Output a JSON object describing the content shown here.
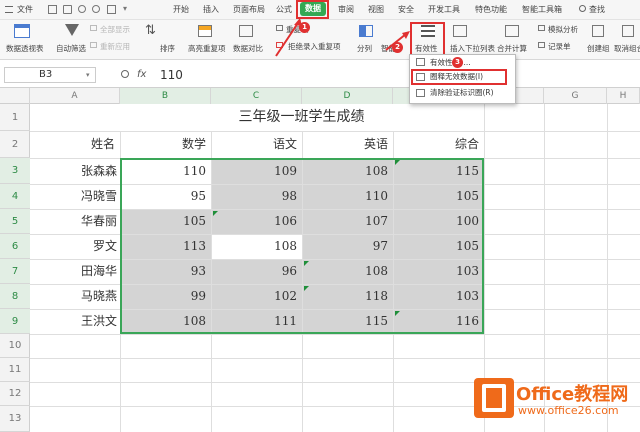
{
  "menubar": {
    "file": "文件",
    "start": "开始",
    "insert": "插入",
    "layout": "页面布局",
    "formula": "公式",
    "data": "数据",
    "review": "审阅",
    "view": "视图",
    "security": "安全",
    "dev": "开发工具",
    "special": "特色功能",
    "smart": "智能工具箱",
    "search": "查找"
  },
  "ribbon": {
    "pivot": "数据透视表",
    "autofilter": "自动筛选",
    "show_all": "全部显示",
    "reapply": "重新应用",
    "sort": "排序",
    "highlight_dup": "高亮重复项",
    "compare": "数据对比",
    "dup_item": "重复项",
    "reject_dup": "拒绝录入重复项",
    "split": "分列",
    "smart_fill": "智能",
    "validation": "有效性",
    "insert_dropdown": "插入下拉列表",
    "consolidate": "合并计算",
    "simulate": "模拟分析",
    "record": "记录单",
    "group": "创建组",
    "ungroup": "取消组合"
  },
  "dropdown": {
    "items": [
      "有效性(V)...",
      "圈释无效数据(I)",
      "清除验证标识圈(R)"
    ]
  },
  "formula_bar": {
    "cell_ref": "B3",
    "fx": "fx",
    "value": "110"
  },
  "callouts": [
    "1",
    "2",
    "3"
  ],
  "columns": [
    "A",
    "B",
    "C",
    "D",
    "E",
    "F",
    "G",
    "H"
  ],
  "rows": [
    "1",
    "2",
    "3",
    "4",
    "5",
    "6",
    "7",
    "8",
    "9",
    "10",
    "11",
    "12",
    "13"
  ],
  "sheet": {
    "title": "三年级一班学生成绩",
    "headers": [
      "姓名",
      "数学",
      "语文",
      "英语",
      "综合"
    ],
    "students": [
      {
        "name": "张森森",
        "scores": [
          110,
          109,
          108,
          115
        ]
      },
      {
        "name": "冯晓雪",
        "scores": [
          95,
          98,
          110,
          105
        ]
      },
      {
        "name": "华春丽",
        "scores": [
          105,
          106,
          107,
          100
        ]
      },
      {
        "name": "罗文",
        "scores": [
          113,
          108,
          97,
          105
        ]
      },
      {
        "name": "田海华",
        "scores": [
          93,
          96,
          108,
          103
        ]
      },
      {
        "name": "马晓燕",
        "scores": [
          99,
          102,
          118,
          103
        ]
      },
      {
        "name": "王洪文",
        "scores": [
          108,
          111,
          115,
          116
        ]
      }
    ]
  },
  "watermark": {
    "line1": "Office教程网",
    "line2": "www.office26.com"
  },
  "colors": {
    "accent": "#34a853",
    "selection": "#3aa658",
    "invalid_fill": "#d4d4d4",
    "annotation": "#e03030",
    "watermark": "#ef6a1a"
  }
}
